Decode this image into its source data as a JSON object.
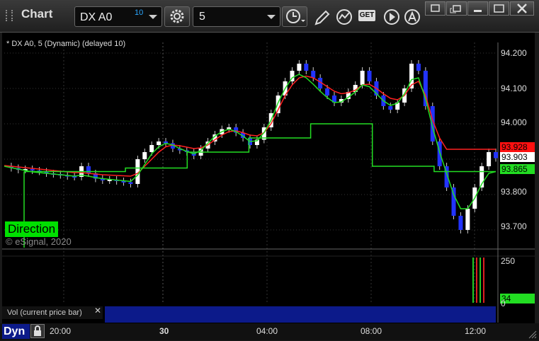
{
  "window": {
    "title": "Chart"
  },
  "toolbar": {
    "symbol": "DX A0",
    "symbol_superscript": "10",
    "interval": "5",
    "get_label": "GET"
  },
  "chart": {
    "legend": "* DX A0, 5 (Dynamic) (delayed 10)",
    "direction_label": "Direction",
    "copyright": "© eSignal, 2020",
    "price_axis": [
      "94.200",
      "94.100",
      "94.000",
      "93.800",
      "93.700"
    ],
    "price_tags": {
      "red": "93.928",
      "last": "93.903",
      "green": "93.865"
    },
    "volume_axis": {
      "top": "250",
      "tag": "34",
      "bottom": "0"
    },
    "volume_label": "Vol (current price bar)",
    "time_axis": [
      "20:00",
      "30",
      "04:00",
      "08:00",
      "12:00"
    ],
    "dyn_label": "Dyn",
    "colors": {
      "red_line": "#ff2020",
      "green_line": "#22dd22",
      "up_candle": "#ffffff",
      "down_candle": "#2233ff",
      "accent": "#0c1a8a"
    }
  },
  "chart_data": {
    "type": "candlestick",
    "y_range": [
      93.65,
      94.23
    ],
    "close_series_approx": [
      93.88,
      93.875,
      93.87,
      93.872,
      93.868,
      93.865,
      93.86,
      93.858,
      93.855,
      93.852,
      93.85,
      93.88,
      93.86,
      93.845,
      93.84,
      93.842,
      93.838,
      93.835,
      93.83,
      93.9,
      93.92,
      93.94,
      93.95,
      93.945,
      93.93,
      93.925,
      93.92,
      93.91,
      93.93,
      93.95,
      93.97,
      93.985,
      93.99,
      93.975,
      93.96,
      93.94,
      93.955,
      93.99,
      94.03,
      94.08,
      94.12,
      94.15,
      94.17,
      94.15,
      94.13,
      94.1,
      94.08,
      94.06,
      94.07,
      94.09,
      94.11,
      94.15,
      94.12,
      94.08,
      94.05,
      94.04,
      94.06,
      94.1,
      94.17,
      94.15,
      94.05,
      93.95,
      93.88,
      93.82,
      93.74,
      93.7,
      93.76,
      93.82,
      93.88,
      93.92,
      93.903
    ],
    "red_line_approx": [
      93.882,
      93.88,
      93.878,
      93.876,
      93.874,
      93.872,
      93.87,
      93.868,
      93.866,
      93.864,
      93.862,
      93.862,
      93.86,
      93.858,
      93.856,
      93.855,
      93.854,
      93.853,
      93.852,
      93.86,
      93.88,
      93.9,
      93.92,
      93.935,
      93.94,
      93.938,
      93.934,
      93.93,
      93.932,
      93.94,
      93.955,
      93.968,
      93.978,
      93.98,
      93.975,
      93.968,
      93.966,
      93.975,
      94.0,
      94.04,
      94.08,
      94.11,
      94.13,
      94.135,
      94.13,
      94.118,
      94.105,
      94.092,
      94.085,
      94.088,
      94.095,
      94.11,
      94.112,
      94.1,
      94.085,
      94.072,
      94.068,
      94.08,
      94.11,
      94.12,
      94.08,
      94.01,
      93.96,
      93.928,
      93.928,
      93.928,
      93.928,
      93.928,
      93.928,
      93.928,
      93.928
    ],
    "green_line_approx": [
      93.88,
      93.876,
      93.872,
      93.868,
      93.864,
      93.862,
      93.86,
      93.858,
      93.856,
      93.854,
      93.852,
      93.855,
      93.852,
      93.848,
      93.845,
      93.843,
      93.841,
      93.839,
      93.837,
      93.855,
      93.885,
      93.915,
      93.935,
      93.945,
      93.94,
      93.93,
      93.922,
      93.915,
      93.925,
      93.945,
      93.965,
      93.978,
      93.985,
      93.978,
      93.965,
      93.95,
      93.952,
      93.975,
      94.01,
      94.06,
      94.1,
      94.13,
      94.14,
      94.13,
      94.112,
      94.092,
      94.074,
      94.06,
      94.062,
      94.075,
      94.09,
      94.11,
      94.105,
      94.085,
      94.065,
      94.052,
      94.058,
      94.085,
      94.125,
      94.13,
      94.07,
      93.99,
      93.92,
      93.86,
      93.8,
      93.76,
      93.76,
      93.79,
      93.83,
      93.86,
      93.865
    ],
    "support_line_levels": [
      93.865,
      93.875,
      93.92,
      93.96,
      94.0,
      93.88,
      93.865
    ],
    "volume_bars_approx": [
      250,
      250,
      250,
      250
    ]
  }
}
